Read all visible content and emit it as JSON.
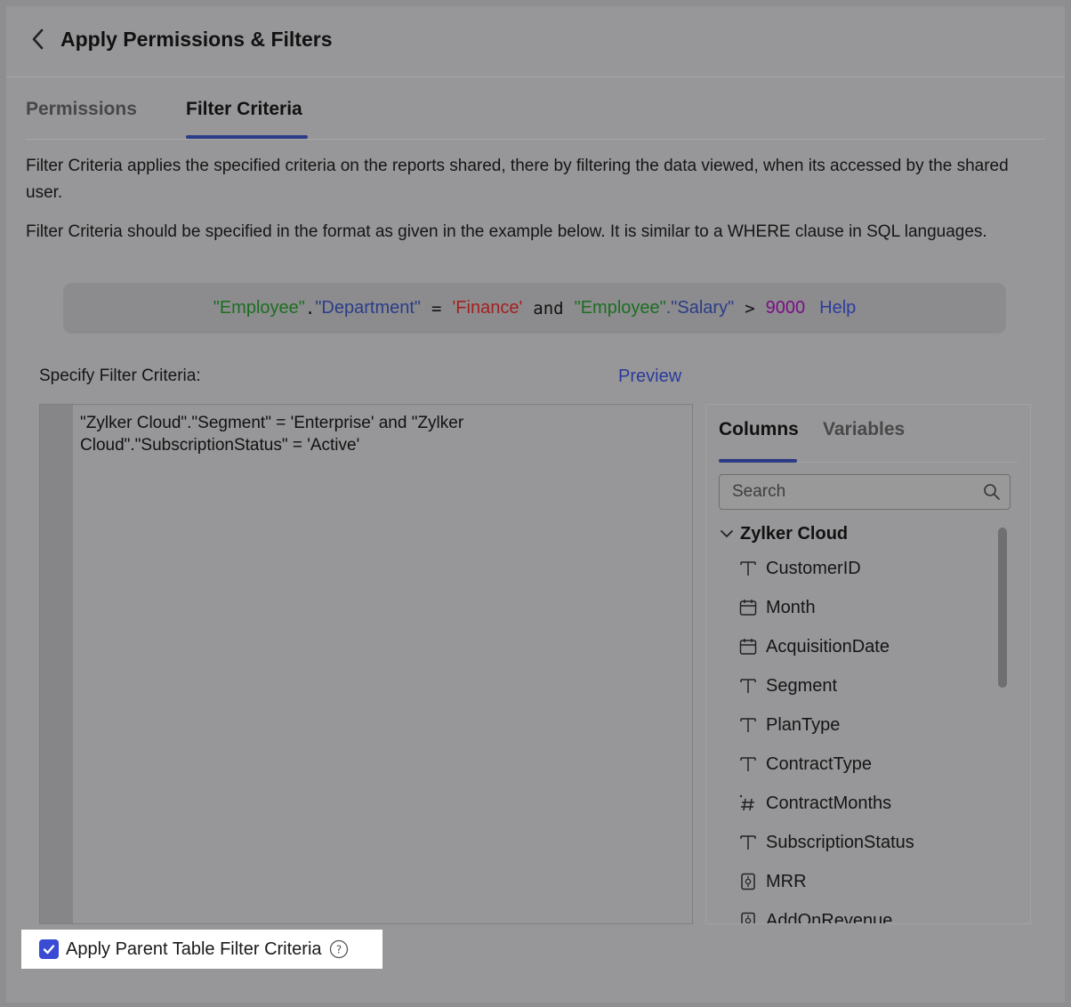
{
  "header": {
    "title": "Apply Permissions & Filters"
  },
  "tabs": [
    {
      "label": "Permissions",
      "active": false
    },
    {
      "label": "Filter Criteria",
      "active": true
    }
  ],
  "description": {
    "line1": "Filter Criteria applies the specified criteria on the reports shared, there by filtering the data viewed, when its accessed by the shared user.",
    "line2": "Filter Criteria should be specified in the format as given in the example below. It is similar to a WHERE clause in SQL languages."
  },
  "example": {
    "table1": "\"Employee\"",
    "dot": ".",
    "column1": "\"Department\"",
    "eq": "=",
    "value1": "'Finance'",
    "and": "and",
    "table2": "\"Employee\"",
    "dot2": ".",
    "column2": "\"Salary\"",
    "gt": ">",
    "value2": "9000",
    "help": "Help"
  },
  "editor": {
    "label": "Specify Filter Criteria:",
    "preview": "Preview",
    "text": "\"Zylker Cloud\".\"Segment\" = 'Enterprise' and \"Zylker Cloud\".\"SubscriptionStatus\" = 'Active'"
  },
  "side_panel": {
    "tabs": [
      {
        "label": "Columns",
        "active": true
      },
      {
        "label": "Variables",
        "active": false
      }
    ],
    "search_placeholder": "Search",
    "table_name": "Zylker Cloud",
    "columns": [
      {
        "label": "CustomerID",
        "icon": "text-type-icon"
      },
      {
        "label": "Month",
        "icon": "calendar-icon"
      },
      {
        "label": "AcquisitionDate",
        "icon": "calendar-icon"
      },
      {
        "label": "Segment",
        "icon": "text-type-icon"
      },
      {
        "label": "PlanType",
        "icon": "text-type-icon"
      },
      {
        "label": "ContractType",
        "icon": "text-type-icon"
      },
      {
        "label": "ContractMonths",
        "icon": "number-icon"
      },
      {
        "label": "SubscriptionStatus",
        "icon": "text-type-icon"
      },
      {
        "label": "MRR",
        "icon": "currency-icon"
      },
      {
        "label": "AddOnRevenue",
        "icon": "currency-icon"
      }
    ]
  },
  "parent_filter": {
    "label": "Apply Parent Table Filter Criteria",
    "checked": true
  },
  "colors": {
    "accent": "#3a4bd4",
    "tab_underline": "#2d3a86",
    "link": "#2c3c9e"
  }
}
